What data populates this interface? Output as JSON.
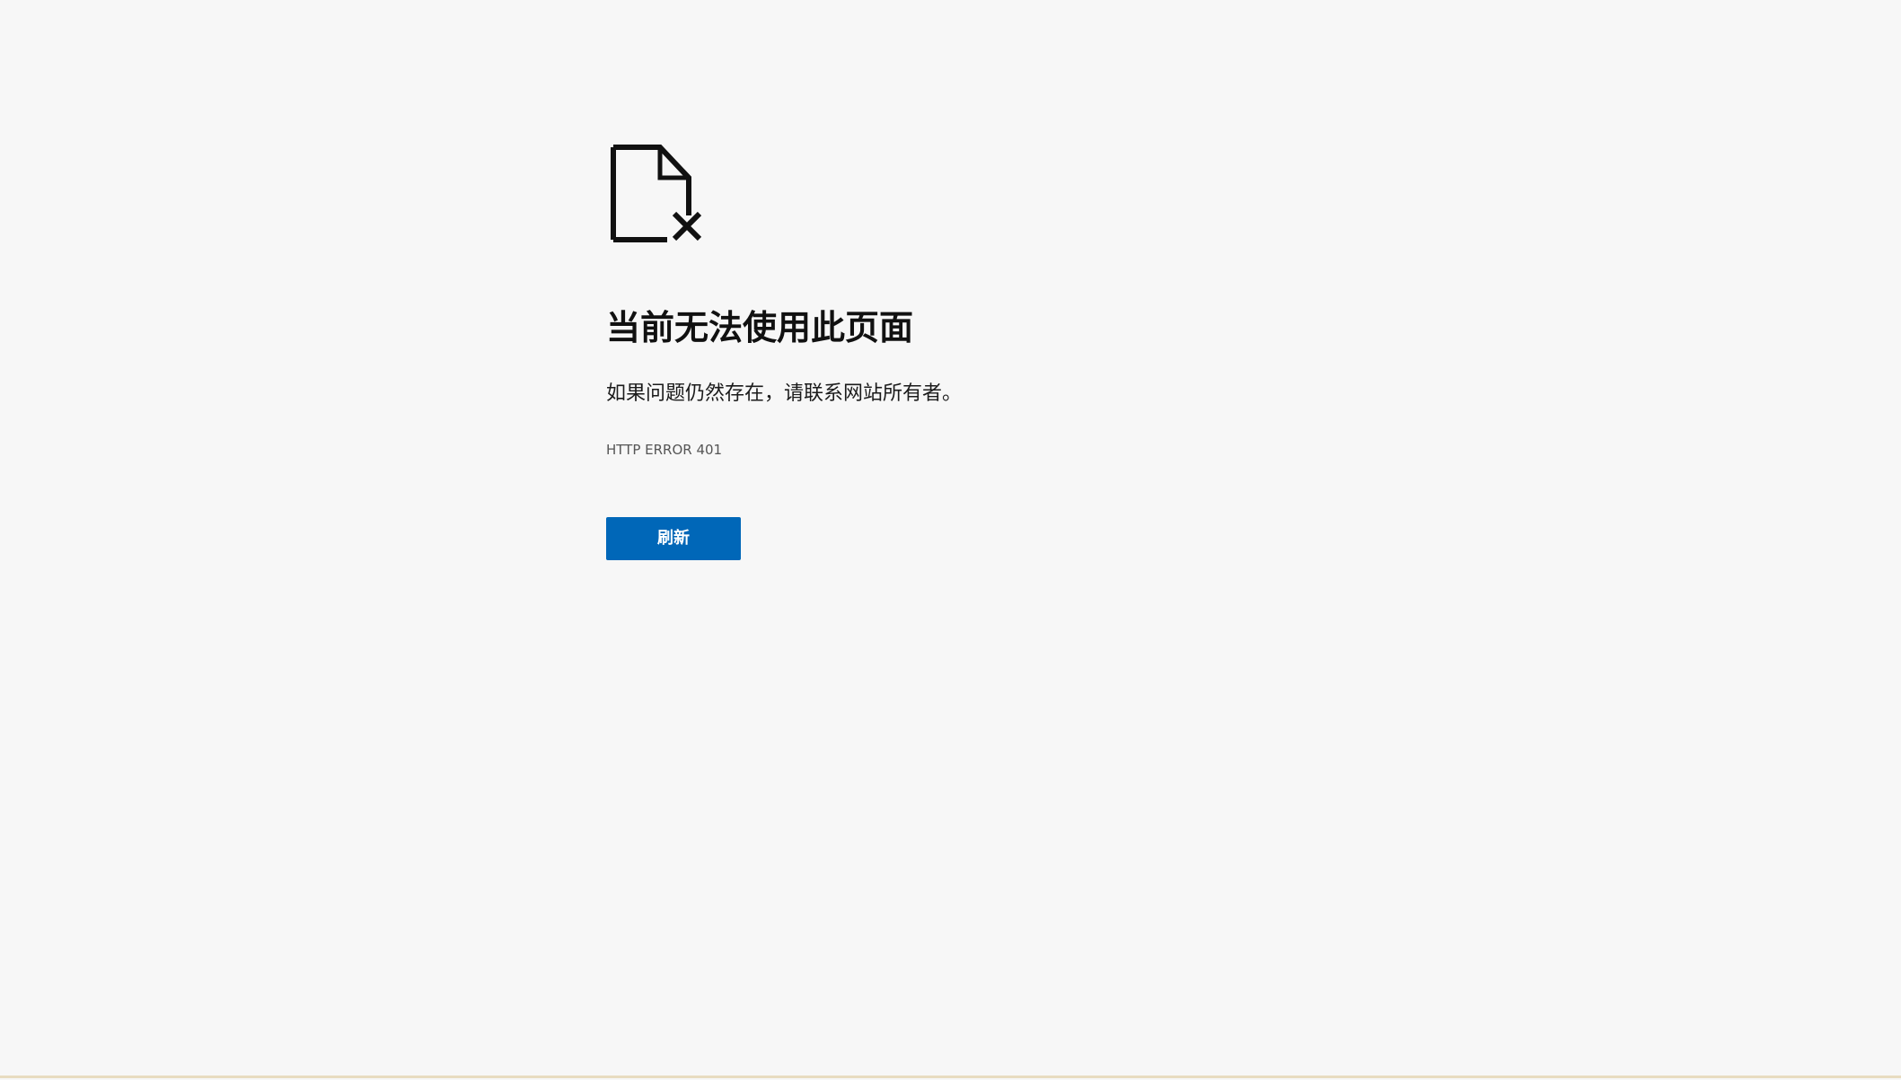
{
  "page": {
    "background": "#f7f7f7"
  },
  "icon": {
    "name": "page-error-icon",
    "color": "#111111"
  },
  "error": {
    "title": "当前无法使用此页面",
    "message": "如果问题仍然存在，请联系网站所有者。",
    "code": "HTTP ERROR 401"
  },
  "actions": {
    "refresh_label": "刷新",
    "accent": "#0067b8"
  }
}
